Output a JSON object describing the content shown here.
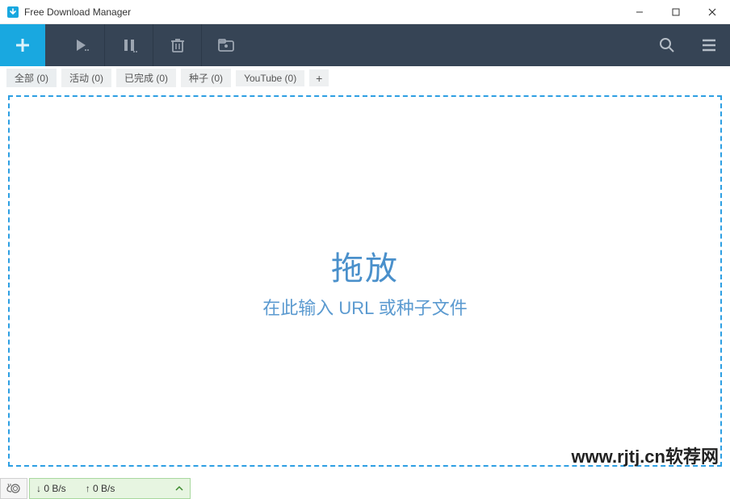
{
  "window": {
    "title": "Free Download Manager"
  },
  "filters": [
    {
      "label": "全部 (0)",
      "active": true
    },
    {
      "label": "活动 (0)",
      "active": false
    },
    {
      "label": "已完成 (0)",
      "active": false
    },
    {
      "label": "种子 (0)",
      "active": false
    },
    {
      "label": "YouTube (0)",
      "active": false
    }
  ],
  "filter_add_label": "+",
  "dropzone": {
    "title": "拖放",
    "subtitle": "在此输入 URL 或种子文件"
  },
  "status": {
    "down_label": "↓ 0 B/s",
    "up_label": "↑ 0 B/s"
  },
  "watermark": "www.rjtj.cn软荐网"
}
